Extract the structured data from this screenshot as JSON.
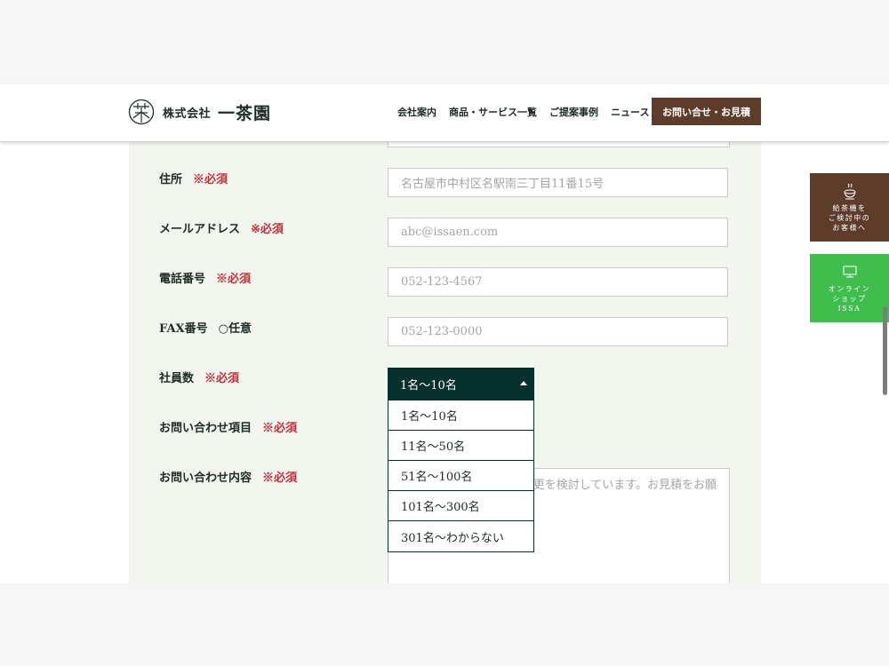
{
  "header": {
    "company_prefix": "株式会社",
    "company_name": "一茶園",
    "nav": [
      "会社案内",
      "商品・サービス一覧",
      "ご提案事例",
      "ニュース"
    ],
    "contact_button": "お問い合せ・お見積"
  },
  "form": {
    "address": {
      "label": "住所",
      "required": "※必須",
      "placeholder": "名古屋市中村区名駅南三丁目11番15号"
    },
    "email": {
      "label": "メールアドレス",
      "required": "※必須",
      "placeholder": "abc@issaen.com"
    },
    "phone": {
      "label": "電話番号",
      "required": "※必須",
      "placeholder": "052-123-4567"
    },
    "fax": {
      "label": "FAX番号",
      "optional": "○任意",
      "placeholder": "052-123-0000"
    },
    "employees": {
      "label": "社員数",
      "required": "※必須",
      "selected": "1名〜10名",
      "options": [
        "1名〜10名",
        "11名〜50名",
        "51名〜100名",
        "101名〜300名",
        "301名〜わからない"
      ]
    },
    "inquiry_item": {
      "label": "お問い合わせ項目",
      "required": "※必須"
    },
    "inquiry_content": {
      "label": "お問い合わせ内容",
      "required": "※必須",
      "placeholder_visible": "更を検討しています。お見積をお願"
    }
  },
  "side": {
    "brown_lines": [
      "給茶機を",
      "ご検討中の",
      "お客様へ"
    ],
    "green_lines": [
      "オンライン",
      "ショップ",
      "ISSA"
    ],
    "brown_icon": "tea-cup-icon",
    "green_icon": "monitor-icon"
  },
  "colors": {
    "brand_brown": "#5e3c2a",
    "dark_green": "#06302c",
    "required_red": "#c0323b",
    "shop_green": "#3fbd4d",
    "panel_bg": "#f3f5ef"
  }
}
